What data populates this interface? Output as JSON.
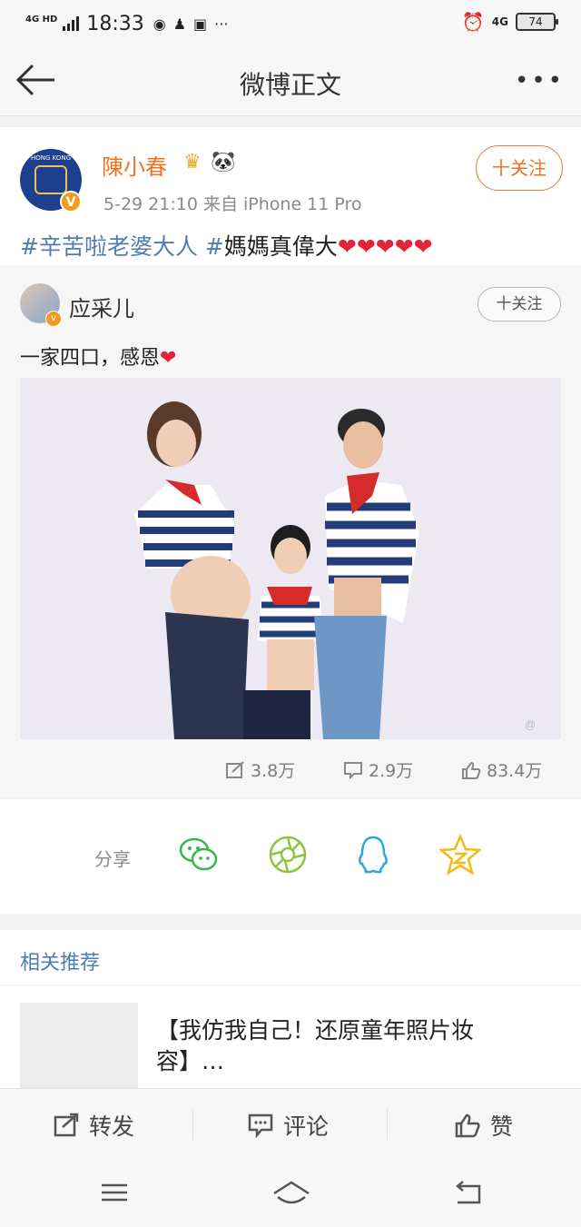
{
  "status_bar": {
    "network": "4G HD",
    "time": "18:33",
    "right_network": "4G",
    "battery": "74"
  },
  "nav": {
    "title": "微博正文"
  },
  "post": {
    "author": "陳小春",
    "avatar_text": "HONG KONG",
    "verified_badge": "V",
    "meta": "5-29 21:10  来自 iPhone 11 Pro",
    "follow_label": "十关注",
    "text_topic1": "#辛苦啦老婆大人",
    "text_topic2": "#",
    "text_plain": "媽媽真偉大",
    "hearts": "❤❤❤❤❤"
  },
  "repost": {
    "author": "应采儿",
    "follow_label": "十关注",
    "text": "一家四口，感恩",
    "heart": "❤"
  },
  "stats": {
    "reposts": "3.8万",
    "comments": "2.9万",
    "likes": "83.4万"
  },
  "share": {
    "label": "分享",
    "targets": [
      "wechat-icon",
      "moments-icon",
      "qq-icon",
      "qzone-icon"
    ]
  },
  "related": {
    "heading": "相关推荐",
    "item_title": "【我仿我自己！还原童年照片妆容】…"
  },
  "actions": {
    "repost": "转发",
    "comment": "评论",
    "like": "赞"
  },
  "colors": {
    "accent_orange": "#f07021",
    "link_blue": "#507daf",
    "heart_red": "#e1243a"
  }
}
